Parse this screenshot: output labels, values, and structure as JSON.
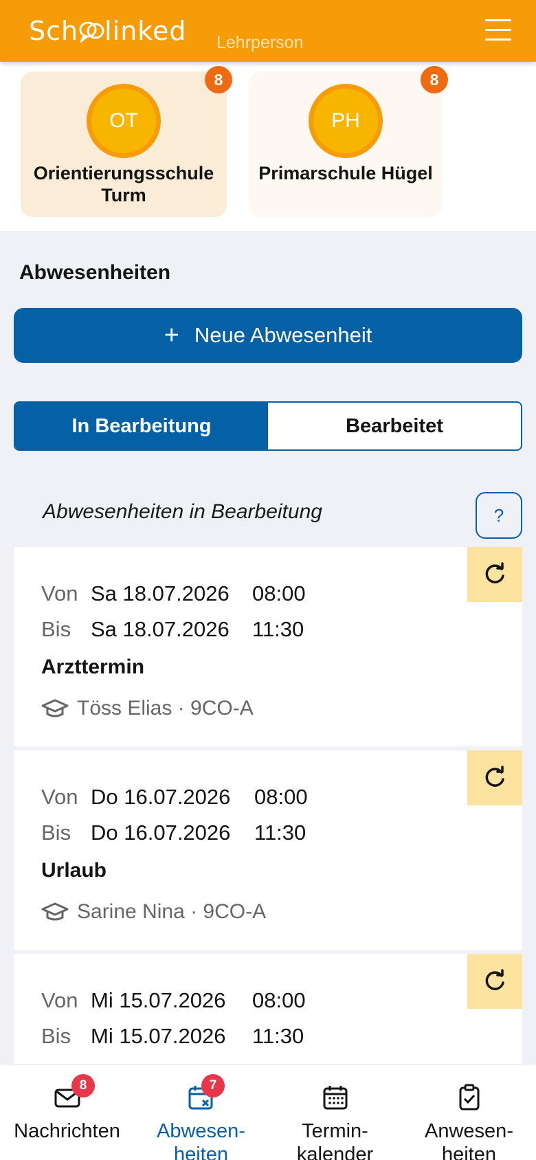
{
  "header": {
    "logo_text": "Schoolinked",
    "role": "Lehrperson"
  },
  "schools": [
    {
      "initials": "OT",
      "name": "Orientierungsschule Turm",
      "badge": "8",
      "active": true
    },
    {
      "initials": "PH",
      "name": "Primarschule Hügel",
      "badge": "8",
      "active": false
    }
  ],
  "section": {
    "title": "Abwesenheiten",
    "new_button": "Neue Abwesenheit"
  },
  "tabs": [
    {
      "label": "In Bearbeitung",
      "active": true
    },
    {
      "label": "Bearbeitet",
      "active": false
    }
  ],
  "list": {
    "heading": "Abwesenheiten in Bearbeitung",
    "help_label": "?"
  },
  "absences": [
    {
      "from_label": "Von",
      "from_date": "Sa 18.07.2026",
      "from_time": "08:00",
      "to_label": "Bis",
      "to_date": "Sa 18.07.2026",
      "to_time": "11:30",
      "reason": "Arzttermin",
      "student": "Töss Elias · 9CO-A"
    },
    {
      "from_label": "Von",
      "from_date": "Do 16.07.2026",
      "from_time": "08:00",
      "to_label": "Bis",
      "to_date": "Do 16.07.2026",
      "to_time": "11:30",
      "reason": "Urlaub",
      "student": "Sarine Nina · 9CO-A"
    },
    {
      "from_label": "Von",
      "from_date": "Mi 15.07.2026",
      "from_time": "08:00",
      "to_label": "Bis",
      "to_date": "Mi 15.07.2026",
      "to_time": "11:30",
      "reason": "",
      "student": ""
    }
  ],
  "bottom_nav": [
    {
      "label": "Nachrichten",
      "icon": "mail-icon",
      "badge": "8",
      "active": false
    },
    {
      "label": "Abwesen-heiten",
      "icon": "calendar-x-icon",
      "badge": "7",
      "active": true
    },
    {
      "label": "Termin-kalender",
      "icon": "calendar-icon",
      "badge": "",
      "active": false
    },
    {
      "label": "Anwesen-heiten",
      "icon": "clipboard-check-icon",
      "badge": "",
      "active": false
    }
  ],
  "colors": {
    "header": "#f59c08",
    "primary": "#0560a6",
    "badge_orange": "#ef6b12",
    "badge_red": "#e8364a",
    "refresh_bg": "#fde3a0"
  }
}
